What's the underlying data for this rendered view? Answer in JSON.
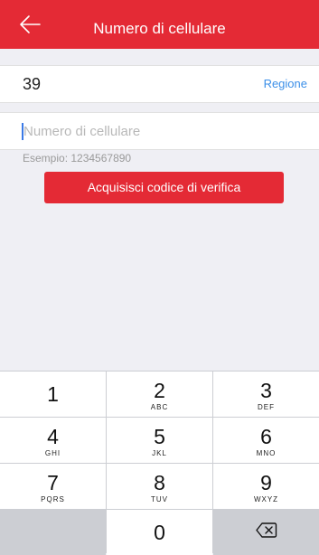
{
  "header": {
    "title": "Numero di cellulare",
    "back_icon": "arrow-left-icon"
  },
  "region_row": {
    "country_code": "39",
    "region_link": "Regione"
  },
  "phone_field": {
    "placeholder": "Numero di cellulare",
    "value": ""
  },
  "example_text": "Esempio: 1234567890",
  "verify_button": "Acquisisci codice di verifica",
  "colors": {
    "brand_red": "#e42a35",
    "link_blue": "#3b8fe8"
  },
  "keypad": {
    "keys": [
      {
        "digit": "1",
        "letters": ""
      },
      {
        "digit": "2",
        "letters": "ABC"
      },
      {
        "digit": "3",
        "letters": "DEF"
      },
      {
        "digit": "4",
        "letters": "GHI"
      },
      {
        "digit": "5",
        "letters": "JKL"
      },
      {
        "digit": "6",
        "letters": "MNO"
      },
      {
        "digit": "7",
        "letters": "PQRS"
      },
      {
        "digit": "8",
        "letters": "TUV"
      },
      {
        "digit": "9",
        "letters": "WXYZ"
      },
      {
        "digit": "0",
        "letters": ""
      }
    ],
    "delete_icon": "backspace-icon"
  }
}
